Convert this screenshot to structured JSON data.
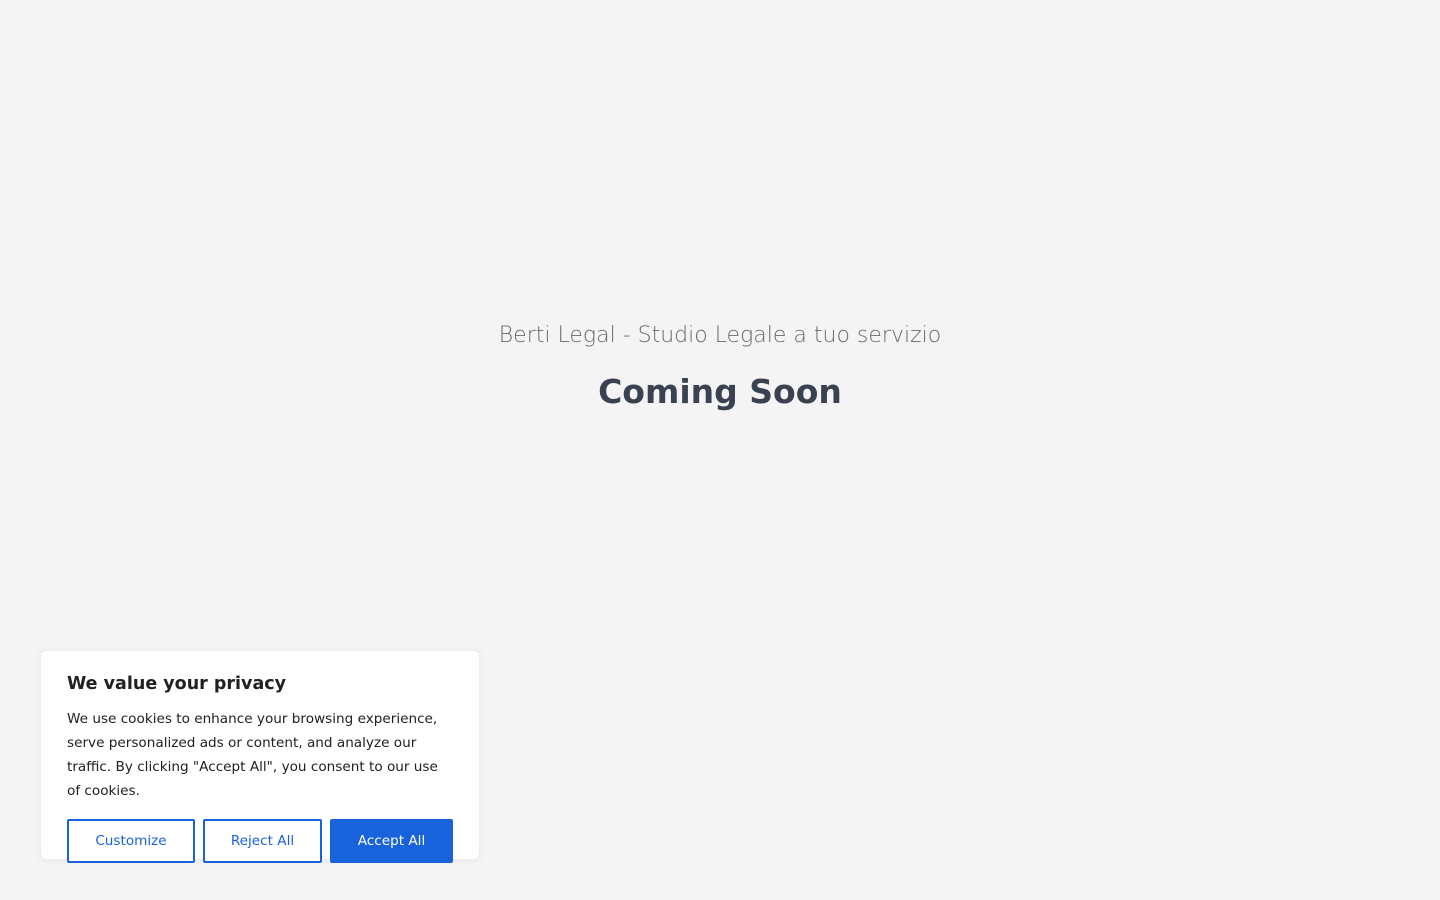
{
  "hero": {
    "tagline": "Berti Legal - Studio Legale a tuo servizio",
    "title": "Coming Soon"
  },
  "cookie_banner": {
    "title": "We value your privacy",
    "text": "We use cookies to enhance your browsing experience, serve personalized ads or content, and analyze our traffic. By clicking \"Accept All\", you consent to our use of cookies.",
    "customize_label": "Customize",
    "reject_label": "Reject All",
    "accept_label": "Accept All"
  },
  "colors": {
    "background": "#f4f4f4",
    "accent": "#1863dc",
    "title_text": "#3a4150",
    "tagline_text": "#666a70"
  }
}
